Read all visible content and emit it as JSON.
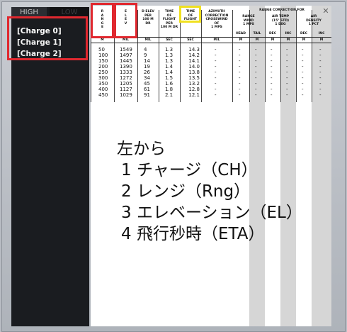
{
  "window": {
    "close_icon": "close-icon"
  },
  "toggle": {
    "high": "HIGH",
    "low": "LOW"
  },
  "charges": [
    "[Charge 0]",
    "[Charge 1]",
    "[Charge 2]"
  ],
  "table": {
    "headers": {
      "range": "R\nA\nN\nG\nE",
      "elev": "E\nL\nE\nV",
      "delev": "D ELEV\nPER\n100 M\nDR",
      "tof_per": "TIME\nOF\nFLIGHT\nPER\n100 M DR",
      "tof": "TIME\nOF\nFLIGHT",
      "azimuth": "AZIMUTH\nCORRECTION\nCROSSWIND\nOF\n1 MPS",
      "range_correction": "RANGE CORRECTION FOR",
      "range_wind": "RANGE\nWIND\n1 MPS",
      "air_temp": "AIR TEMP\n(15° STD)\n1 DEG",
      "air_density": "AIR\nDENSITY\n1 PCT",
      "head": "HEAD",
      "tail": "TAIL",
      "dec1": "DEC",
      "inc1": "INC",
      "dec2": "DEC",
      "inc2": "INC"
    },
    "units": {
      "range": "M",
      "elev": "MIL",
      "delev": "MIL",
      "tof_per": "SEC",
      "tof": "SEC",
      "azimuth": "MIL",
      "head": "M",
      "tail": "M",
      "dec1": "M",
      "inc1": "M",
      "dec2": "M",
      "inc2": "M"
    },
    "rows": [
      {
        "range": "50",
        "elev": "1549",
        "delev": "4",
        "tofper": "1.3",
        "tof": "14.3"
      },
      {
        "range": "100",
        "elev": "1497",
        "delev": "9",
        "tofper": "1.3",
        "tof": "14.2"
      },
      {
        "range": "150",
        "elev": "1445",
        "delev": "14",
        "tofper": "1.3",
        "tof": "14.1"
      },
      {
        "range": "200",
        "elev": "1390",
        "delev": "19",
        "tofper": "1.4",
        "tof": "14.0"
      },
      {
        "range": "250",
        "elev": "1333",
        "delev": "26",
        "tofper": "1.4",
        "tof": "13.8"
      },
      {
        "range": "300",
        "elev": "1272",
        "delev": "34",
        "tofper": "1.5",
        "tof": "13.5"
      },
      {
        "range": "350",
        "elev": "1205",
        "delev": "45",
        "tofper": "1.6",
        "tof": "13.2"
      },
      {
        "range": "400",
        "elev": "1127",
        "delev": "61",
        "tofper": "1.8",
        "tof": "12.8"
      },
      {
        "range": "450",
        "elev": "1029",
        "delev": "91",
        "tofper": "2.1",
        "tof": "12.1"
      }
    ],
    "dash": "-"
  },
  "notes": {
    "heading": "左から",
    "items": [
      "1 チャージ（CH）",
      "2 レンジ（Rng）",
      "3 エレベーション（EL）",
      "4 飛行秒時（ETA）"
    ]
  },
  "colors": {
    "highlight_red": "#e0282f",
    "highlight_yellow": "#f0e020",
    "panel_bg": "#1a1c20"
  }
}
